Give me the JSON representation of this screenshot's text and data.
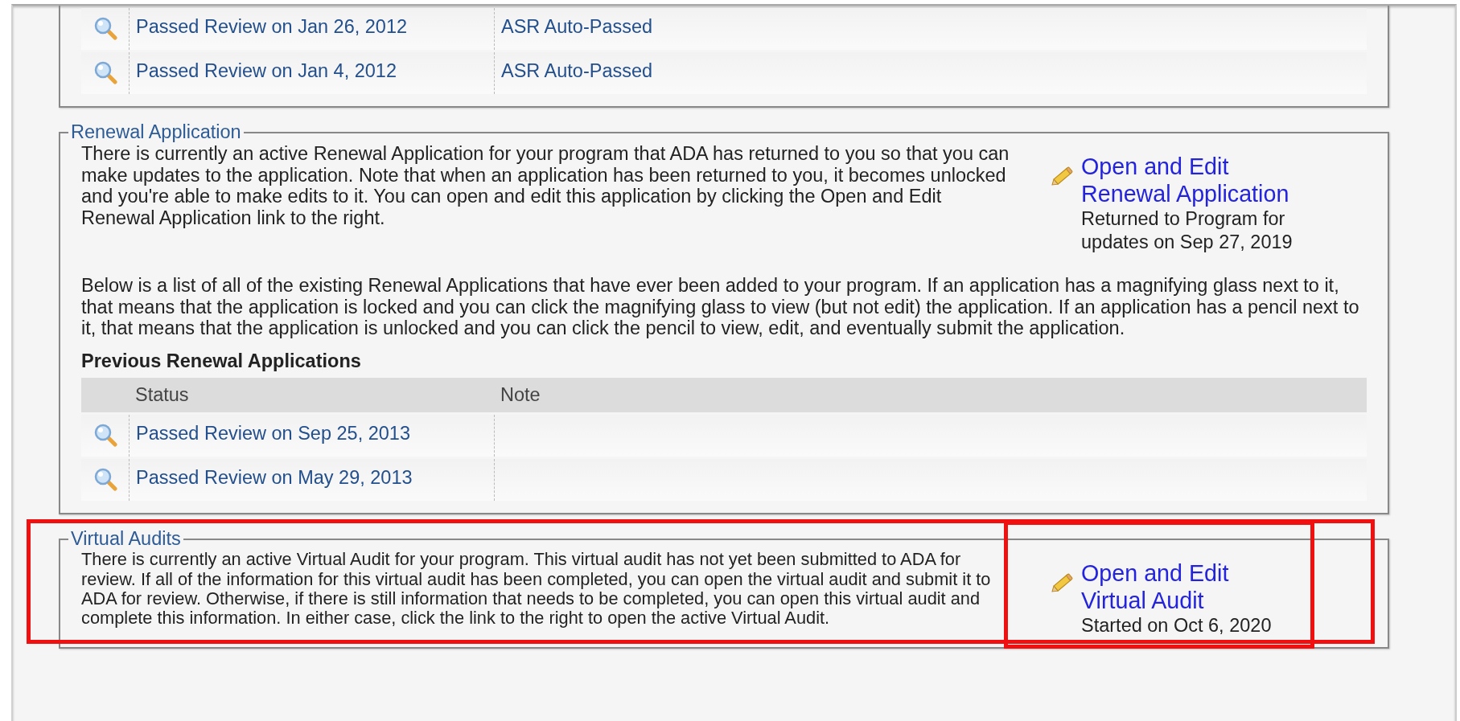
{
  "top_table": {
    "rows": [
      {
        "status": "Passed Review on Jan 26, 2012",
        "note": "ASR Auto-Passed"
      },
      {
        "status": "Passed Review on Jan 4, 2012",
        "note": "ASR Auto-Passed"
      }
    ]
  },
  "sections": [
    {
      "legend": "Renewal Application",
      "highlighted": false,
      "kind": "detailed",
      "description": "There is currently an active Renewal Application for your program that ADA has returned to you so that you can make updates to the application. Note that when an application has been returned to you, it becomes unlocked and you're able to make edits to it. You can open and edit this application by clicking the Open and Edit Renewal Application link to the right.",
      "action": {
        "link": "Open and Edit Renewal Application",
        "detail": "Returned to Program for updates on Sep 27, 2019",
        "highlighted": false
      },
      "list_intro": "Below is a list of all of the existing Renewal Applications that have ever been added to your program. If an application has a magnifying glass next to it, that means that the application is locked and you can click the magnifying glass to view (but not edit) the application. If an application has a pencil next to it, that means that the application is unlocked and you can click the pencil to view, edit, and eventually submit the application.",
      "table": {
        "title": "Previous Renewal Applications",
        "columns": [
          "Status",
          "Note"
        ],
        "rows": [
          {
            "status": "Passed Review on Sep 25, 2013"
          },
          {
            "status": "Passed Review on May 29, 2013"
          }
        ]
      }
    },
    {
      "legend": "Virtual Audits",
      "highlighted": true,
      "kind": "brief",
      "description": "There is currently an active Virtual Audit for your program. This virtual audit has not yet been submitted to ADA for review. If all of the information for this virtual audit has been completed, you can open the virtual audit and submit it to ADA for review. Otherwise, if there is still information that needs to be completed, you can open this virtual audit and complete this information. In either case, click the link to the right to open the active Virtual Audit.",
      "action": {
        "link": "Open and Edit Virtual Audit",
        "detail": "Started on Oct 6, 2020",
        "highlighted": true
      }
    }
  ]
}
